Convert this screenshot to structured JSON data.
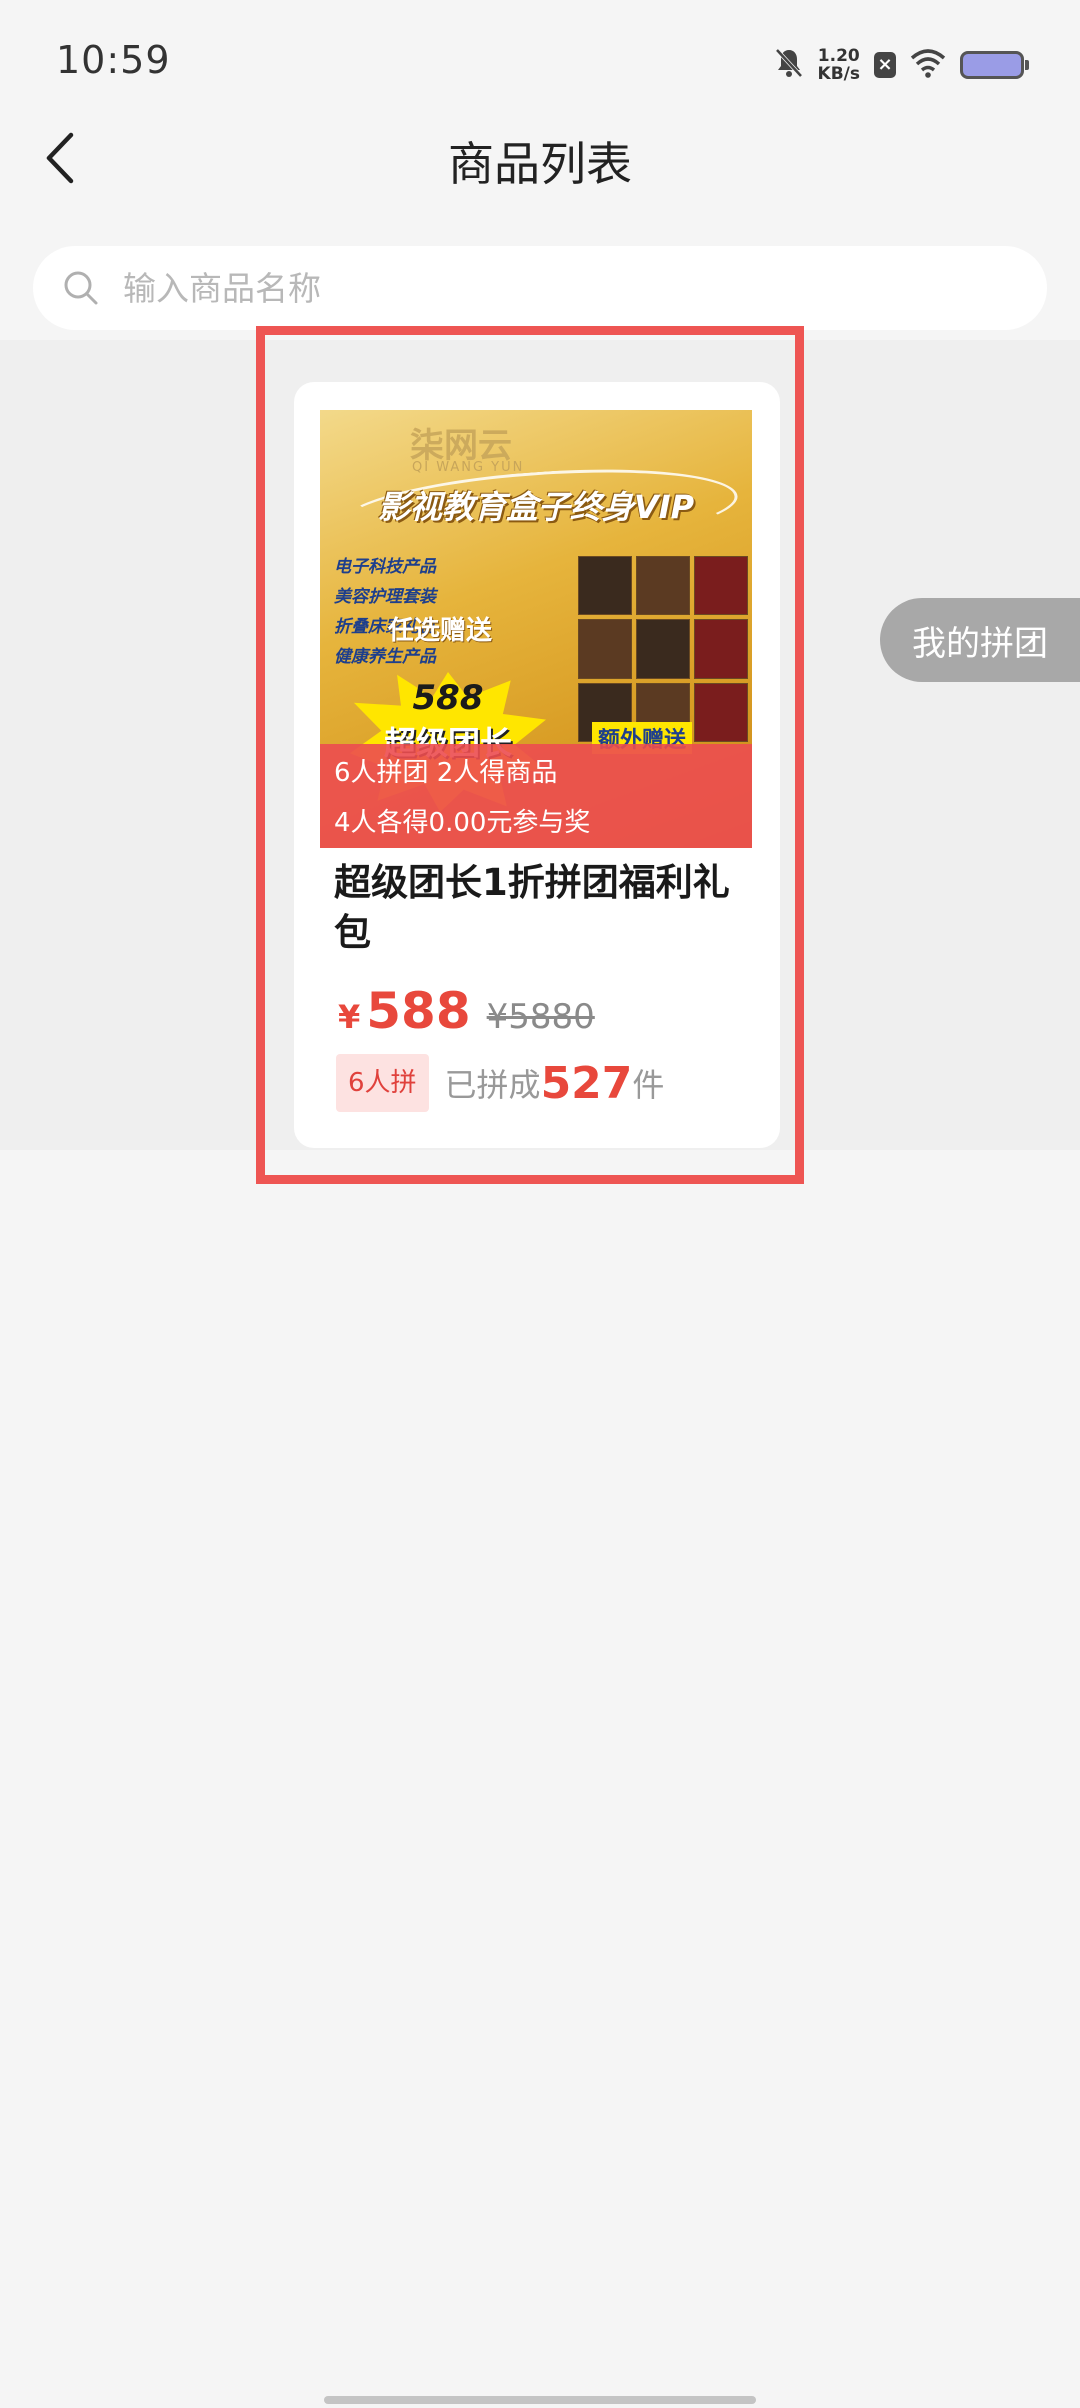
{
  "status_bar": {
    "time": "10:59",
    "net_speed_value": "1.20",
    "net_speed_unit": "KB/s",
    "icons": [
      "bell-off-icon",
      "x-badge-icon",
      "wifi-icon",
      "battery-icon"
    ]
  },
  "nav": {
    "title": "商品列表",
    "back_icon": "chevron-left-icon"
  },
  "search": {
    "placeholder": "输入商品名称",
    "value": ""
  },
  "product": {
    "image_overlay_line1": "6人拼团 2人得商品",
    "image_overlay_line2": "4人各得0.00元参与奖",
    "image_text": {
      "logo": "柒网云",
      "logo_sub": "QI WANG YUN",
      "banner": "影视教育盒子终身VIP",
      "tags": [
        "电子科技产品",
        "美容护理套装",
        "折叠床家礼盒",
        "健康养生产品"
      ],
      "gift": "任选赠送",
      "burst_number": "588",
      "burst_text": "超级团长",
      "extra": "额外赠送"
    },
    "name": "超级团长1折拼团福利礼包",
    "currency": "¥",
    "price": "588",
    "original_price": "¥5880",
    "group_badge": "6人拼",
    "sold_prefix": "已拼成",
    "sold_count": "527",
    "sold_unit": "件"
  },
  "floating": {
    "my_group_label": "我的拼团"
  },
  "colors": {
    "accent": "#e8483c",
    "highlight_frame": "#ee5553",
    "background": "#f5f5f5",
    "floating_button": "#a8a8a8"
  }
}
